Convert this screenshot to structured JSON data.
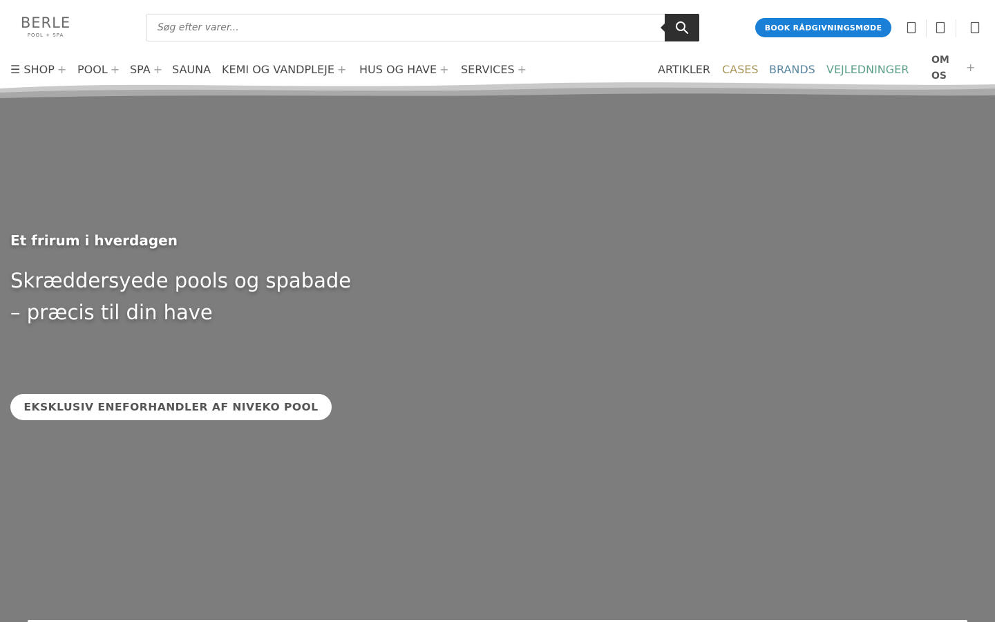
{
  "brand": {
    "name": "BERLE",
    "tagline": "POOL + SPA"
  },
  "search": {
    "placeholder": "Søg efter varer..."
  },
  "header": {
    "book_label": "BOOK RÅDGIVNINGSMØDE"
  },
  "nav": {
    "items": [
      {
        "label": "☰ SHOP",
        "plus": "+"
      },
      {
        "label": "POOL",
        "plus": "+"
      },
      {
        "label": "SPA",
        "plus": "+"
      },
      {
        "label": "SAUNA",
        "plus": ""
      },
      {
        "label": "KEMI OG VANDPLEJE",
        "plus": "+"
      },
      {
        "label": "HUS OG HAVE",
        "plus": "+"
      },
      {
        "label": "SERVICES",
        "plus": "+"
      }
    ],
    "right_items": [
      {
        "label": "ARTIKLER",
        "color": "#4a4a4a"
      },
      {
        "label": "CASES",
        "color": "#a8975a"
      },
      {
        "label": "BRANDS",
        "color": "#5a86a0"
      },
      {
        "label": "VEJLEDNINGER",
        "color": "#5fa08a"
      }
    ],
    "om_os_line1": "OM",
    "om_os_line2": "OS",
    "om_os_plus": "+"
  },
  "hero": {
    "kicker": "Et frirum i hverdagen",
    "title_line1": "Skræddersyede pools og spabade",
    "title_line2": "– præcis til din have",
    "cta": "EKSKLUSIV ENEFORHANDLER AF NIVEKO POOL",
    "background": "#7d7d7d"
  },
  "icons": {
    "search": "search-icon",
    "account": "user-icon",
    "wishlist": "heart-icon",
    "cart": "cart-icon"
  }
}
